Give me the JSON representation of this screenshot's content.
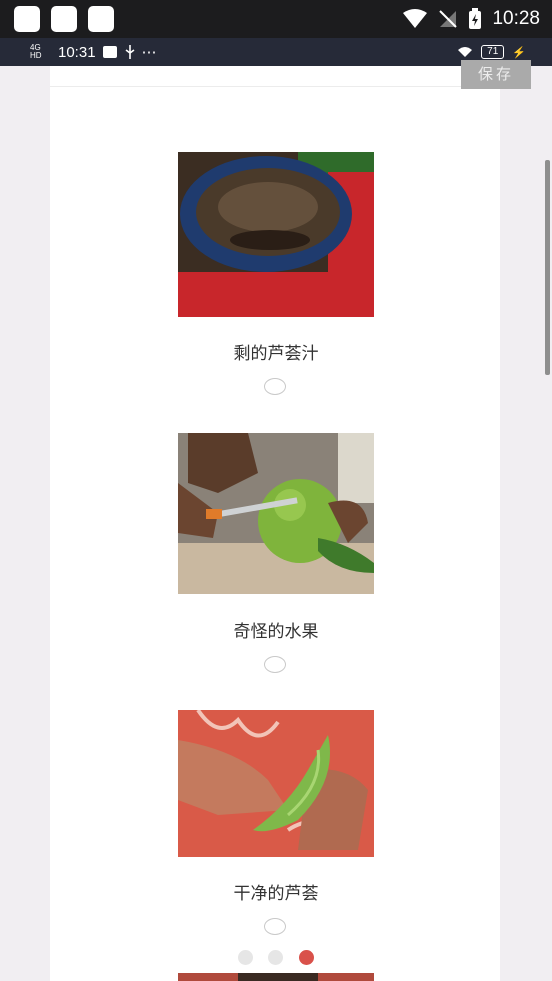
{
  "status_bar": {
    "time": "10:28"
  },
  "inner_status_bar": {
    "network": "4G HD",
    "time": "10:31",
    "battery": "71"
  },
  "save_button": {
    "label": "保存"
  },
  "items": [
    {
      "label": "剩的芦荟汁",
      "photo": "basket-bowl-photo"
    },
    {
      "label": "奇怪的水果",
      "photo": "cutting-fruit-photo"
    },
    {
      "label": "干净的芦荟",
      "photo": "aloe-leaf-photo"
    }
  ],
  "pager": {
    "count": 3,
    "active_index": 2,
    "active_color": "#d9514a",
    "inactive_color": "#e6e6e6"
  }
}
